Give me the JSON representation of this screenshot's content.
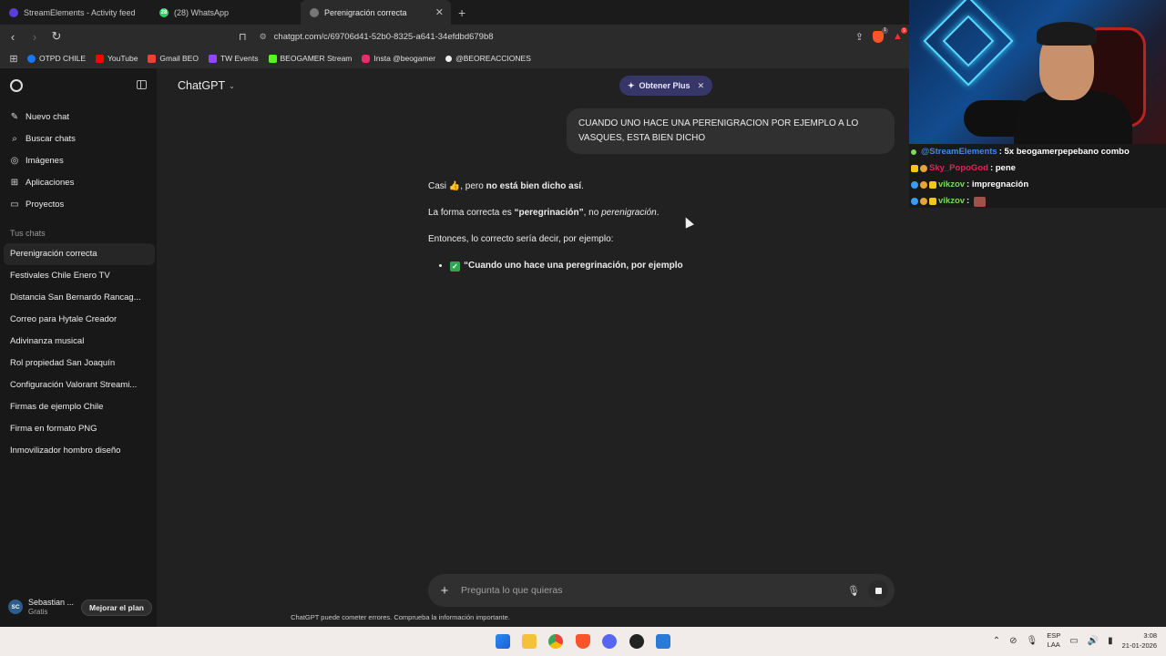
{
  "tabs": [
    {
      "title": "StreamElements - Activity feed",
      "icon_color": "#5a3fd6"
    },
    {
      "title": "(28) WhatsApp",
      "badge": "28",
      "icon_color": "#25d366"
    },
    {
      "title": "Perenigración correcta",
      "icon_color": "#888888",
      "active": true
    }
  ],
  "address": {
    "url": "chatgpt.com/c/69706d41-52b0-8325-a641-34efdbd679b8",
    "shields_badge": "1",
    "rewards_badge": "9"
  },
  "bookmarks": [
    {
      "label": "OTPD CHILE",
      "icon": "facebook-icon",
      "color": "#1877f2"
    },
    {
      "label": "YouTube",
      "icon": "youtube-icon",
      "color": "#ff0000"
    },
    {
      "label": "Gmail BEO",
      "icon": "gmail-icon",
      "color": "#ea4335"
    },
    {
      "label": "TW Events",
      "icon": "twitch-icon",
      "color": "#9146ff"
    },
    {
      "label": "BEOGAMER Stream",
      "icon": "kick-icon",
      "color": "#53fc18"
    },
    {
      "label": "Insta @beogamer",
      "icon": "instagram-icon",
      "color": "#e1306c"
    },
    {
      "label": "@BEOREACCIONES",
      "icon": "tiktok-icon",
      "color": "#ffffff"
    }
  ],
  "sidebar": {
    "menu": [
      {
        "label": "Nuevo chat",
        "icon": "edit-icon"
      },
      {
        "label": "Buscar chats",
        "icon": "search-icon"
      },
      {
        "label": "Imágenes",
        "icon": "image-icon"
      },
      {
        "label": "Aplicaciones",
        "icon": "apps-icon"
      },
      {
        "label": "Proyectos",
        "icon": "folder-icon"
      }
    ],
    "section_title": "Tus chats",
    "chats": [
      "Perenigración correcta",
      "Festivales Chile Enero TV",
      "Distancia San Bernardo Rancag...",
      "Correo para Hytale Creador",
      "Adivinanza musical",
      "Rol propiedad San Joaquín",
      "Configuración Valorant Streami...",
      "Firmas de ejemplo Chile",
      "Firma en formato PNG",
      "Inmovilizador hombro diseño"
    ],
    "user": {
      "initials": "SC",
      "name": "Sebastian ...",
      "plan": "Gratis"
    },
    "upgrade_label": "Mejorar el plan"
  },
  "main": {
    "model": "ChatGPT",
    "plus_pill": "Obtener Plus",
    "user_message": "CUANDO UNO HACE UNA PERENIGRACION POR EJEMPLO A LO VASQUES, ESTA BIEN DICHO",
    "answer": {
      "p1_a": "Casi 👍, pero ",
      "p1_b": "no está bien dicho así",
      "p1_c": ".",
      "p2_a": "La forma correcta es ",
      "p2_b": "“peregrinación”",
      "p2_c": ", no ",
      "p2_d": "perenigración",
      "p2_e": ".",
      "p3": "Entonces, lo correcto sería decir, por ejemplo:",
      "bullet": "“Cuando uno hace una peregrinación, por ejemplo"
    },
    "composer_placeholder": "Pregunta lo que quieras",
    "disclaimer": "ChatGPT puede cometer errores. Comprueba la información importante."
  },
  "stream_chat": [
    {
      "user": "@StreamElements",
      "user_color": "#4a86e8",
      "text": ": 5x beogamerpepebano combo"
    },
    {
      "user": "Sky_PopoGod",
      "user_color": "#e0245e",
      "text": ": pene"
    },
    {
      "user": "vikzov",
      "user_color": "#7ed957",
      "text": ": impregnación"
    },
    {
      "user": "vikzov",
      "user_color": "#7ed957",
      "text": ":"
    }
  ],
  "taskbar": {
    "lang_1": "ESP",
    "lang_2": "LAA",
    "time": "3:08",
    "date": "21-01-2026"
  }
}
